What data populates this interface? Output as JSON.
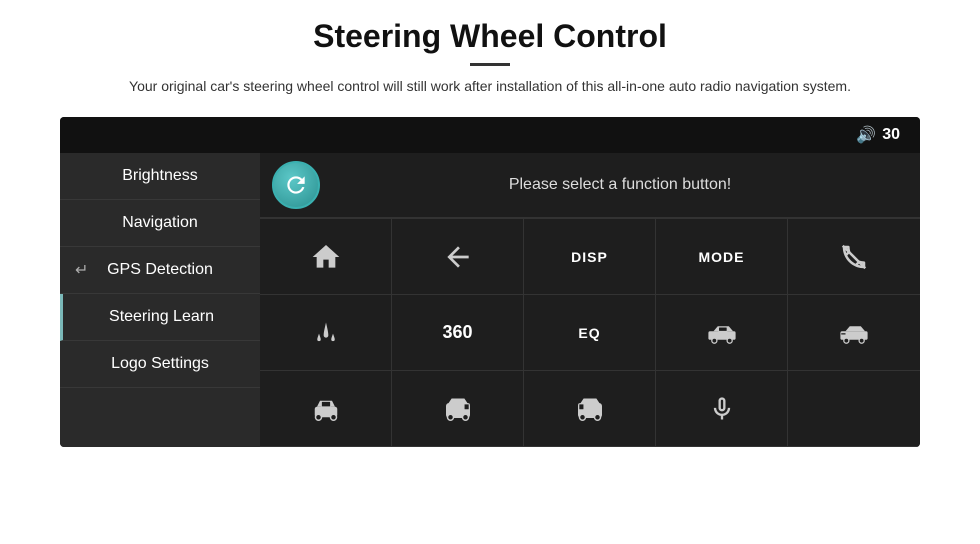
{
  "header": {
    "title": "Steering Wheel Control",
    "divider": true,
    "subtitle": "Your original car's steering wheel control will still work after installation of this all-in-one auto radio navigation system."
  },
  "topbar": {
    "volume_icon": "🔊",
    "volume_value": "30"
  },
  "sidebar": {
    "items": [
      {
        "label": "Brightness",
        "active": false
      },
      {
        "label": "Navigation",
        "active": false
      },
      {
        "label": "GPS Detection",
        "active": false
      },
      {
        "label": "Steering Learn",
        "active": true
      },
      {
        "label": "Logo Settings",
        "active": false
      }
    ]
  },
  "function_bar": {
    "refresh_icon": "↺",
    "text": "Please select a function button!"
  },
  "grid": {
    "rows": [
      [
        {
          "type": "icon",
          "content": "home"
        },
        {
          "type": "icon",
          "content": "back"
        },
        {
          "type": "label",
          "content": "DISP"
        },
        {
          "type": "label",
          "content": "MODE"
        },
        {
          "type": "icon",
          "content": "phone-slash"
        }
      ],
      [
        {
          "type": "icon",
          "content": "equalizer"
        },
        {
          "type": "label-lg",
          "content": "360"
        },
        {
          "type": "label",
          "content": "EQ"
        },
        {
          "type": "icon",
          "content": "car-side1"
        },
        {
          "type": "icon",
          "content": "car-side2"
        }
      ],
      [
        {
          "type": "icon",
          "content": "car-front"
        },
        {
          "type": "icon",
          "content": "car-box1"
        },
        {
          "type": "icon",
          "content": "car-box2"
        },
        {
          "type": "icon",
          "content": "mic"
        },
        {
          "type": "empty"
        }
      ]
    ]
  }
}
